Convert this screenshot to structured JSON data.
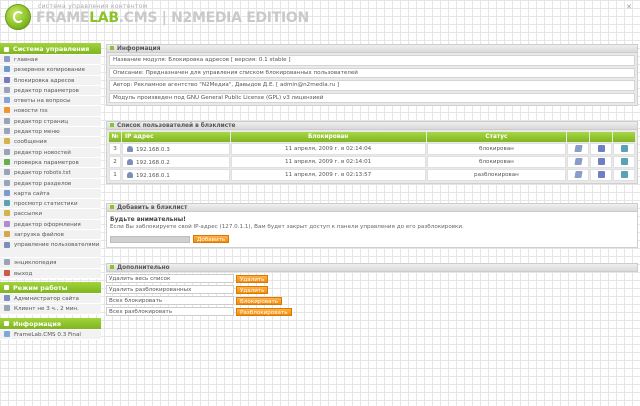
{
  "header": {
    "subtitle": "система управления контентом",
    "brand_frame": "FRAME",
    "brand_lab": "LAB",
    "brand_cms": ".CMS",
    "brand_edition": "| N2MEDIA EDITION",
    "close_glyph": "✕"
  },
  "sidebar": {
    "sections": [
      {
        "title": "Система управления",
        "items": [
          {
            "label": "главная",
            "icon": "home-icon",
            "color": "#8a9cc9"
          },
          {
            "label": "резервное копирование",
            "icon": "backup-icon",
            "color": "#6e9ad0"
          },
          {
            "label": "блокировка адресов",
            "icon": "block-icon",
            "color": "#7a7ac0"
          },
          {
            "label": "редактор параметров",
            "icon": "params-icon",
            "color": "#9aa4b8"
          },
          {
            "label": "ответы на вопросы",
            "icon": "faq-icon",
            "color": "#7fa6d6"
          },
          {
            "label": "новости rss",
            "icon": "rss-icon",
            "color": "#f0962a"
          },
          {
            "label": "редактор страниц",
            "icon": "pages-icon",
            "color": "#9aa4b8"
          },
          {
            "label": "редактор меню",
            "icon": "menu-icon",
            "color": "#9aa4b8"
          },
          {
            "label": "сообщения",
            "icon": "messages-icon",
            "color": "#d6b34a"
          },
          {
            "label": "редактор новостей",
            "icon": "news-icon",
            "color": "#9aa4b8"
          },
          {
            "label": "проверка параметров",
            "icon": "check-icon",
            "color": "#6ab04a"
          },
          {
            "label": "редактор robots.txt",
            "icon": "robots-icon",
            "color": "#9aa4b8"
          },
          {
            "label": "редактор разделов",
            "icon": "sections-icon",
            "color": "#9aa4b8"
          },
          {
            "label": "карта сайта",
            "icon": "sitemap-icon",
            "color": "#7a9ad0"
          },
          {
            "label": "просмотр статистики",
            "icon": "stats-icon",
            "color": "#59a3b3"
          },
          {
            "label": "рассылки",
            "icon": "mail-icon",
            "color": "#d6b34a"
          },
          {
            "label": "редактор оформления",
            "icon": "design-icon",
            "color": "#b38ad0"
          },
          {
            "label": "загрузка файлов",
            "icon": "upload-icon",
            "color": "#d6a84a"
          },
          {
            "label": "управление пользователями",
            "icon": "users-icon",
            "color": "#7b8fb8",
            "tall": true
          },
          {
            "label": "энциклопедия",
            "icon": "encyclopedia-icon",
            "color": "#9aa4b8"
          },
          {
            "label": "выход",
            "icon": "exit-icon",
            "color": "#d05a4a"
          }
        ]
      },
      {
        "title": "Режим работы",
        "items": [
          {
            "label": "Администратор сайта",
            "icon": "admin-icon",
            "color": "#7b8fb8"
          },
          {
            "label": "Клиент не 3 ч., 2 мин.",
            "icon": "clock-icon",
            "color": "#9aa4b8"
          }
        ]
      },
      {
        "title": "Информация",
        "items": [
          {
            "label": "FrameLab.CMS 0.3 Final",
            "icon": "info-icon",
            "color": "#7fa6d6"
          }
        ]
      }
    ]
  },
  "info_panel": {
    "title": "Информация",
    "rows": [
      "Название модуля: Блокировка адресов [ версия: 0.1 stable ]",
      "Описание: Предназначен для управления списком блокированных пользователей",
      "Автор: Рекламное агентство \"N2Медиа\", Давыдов Д.Е. [ admin@n2media.ru ]",
      "Модуль произведен под GNU General Public License (GPL) v3 лицензией"
    ]
  },
  "blacklist": {
    "title": "Список пользователей в блэклисте",
    "columns": [
      "№",
      "IP адрес",
      "Блокирован",
      "Статус"
    ],
    "rows": [
      {
        "num": "3",
        "ip": "192.168.0.3",
        "date": "11 апреля, 2009 г. в 02:14:04",
        "status": "блокирован"
      },
      {
        "num": "2",
        "ip": "192.168.0.2",
        "date": "11 апреля, 2009 г. в 02:14:01",
        "status": "блокирован"
      },
      {
        "num": "1",
        "ip": "192.168.0.1",
        "date": "11 апреля, 2009 г. в 02:13:57",
        "status": "разблокирован"
      }
    ]
  },
  "add_panel": {
    "title": "Добавить в блэклист",
    "warning_title": "Будьте внимательны!",
    "warning_text": "Если Вы заблокируете свой IP-адрес (127.0.1.1), Вам будет закрыт доступ к панели управления до его разблокировки.",
    "input_value": "",
    "button_label": "Добавить"
  },
  "extra_panel": {
    "title": "Дополнительно",
    "rows": [
      {
        "label": "Удалить весь список",
        "button": "Удалить"
      },
      {
        "label": "Удалить разблокированных",
        "button": "Удалить"
      },
      {
        "label": "Всех блокировать",
        "button": "Блокировать"
      },
      {
        "label": "Всех разблокировать",
        "button": "Разблокировать"
      }
    ]
  },
  "colors": {
    "accent_green": "#8cc22a",
    "button_orange": "#f08c10"
  }
}
